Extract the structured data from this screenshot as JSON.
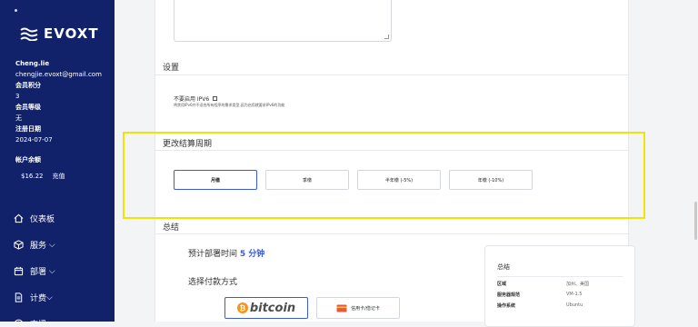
{
  "brand": {
    "name": "EVOXT"
  },
  "account": {
    "username": "Cheng.lie",
    "email": "chengjie.evoxt@gmail.com",
    "points_label": "会员积分",
    "points_value": "3",
    "level_label": "会员等级",
    "level_value": "无",
    "reg_label": "注册日期",
    "reg_value": "2024-07-07",
    "balance_label": "帐户余额",
    "balance_value": "$16.22",
    "recharge_label": "充值"
  },
  "nav": {
    "items": [
      {
        "label": "仪表板",
        "icon": "home-icon"
      },
      {
        "label": "服务",
        "icon": "box-icon"
      },
      {
        "label": "部署",
        "icon": "calendar-icon"
      },
      {
        "label": "计费",
        "icon": "document-icon"
      },
      {
        "label": "支援",
        "icon": "help-icon"
      }
    ]
  },
  "settings": {
    "title": "设置",
    "ipv6_label": "不要启用 IPV6",
    "ipv6_note": "将禁用IPv6并不适合所有程序的需求类型,因为启用就要求IPv6的功能"
  },
  "billing_cycle": {
    "title": "更改结算周期",
    "options": [
      "月缴",
      "季缴",
      "半年缴 (-5%)",
      "年缴 (-10%)"
    ],
    "selected": "月缴"
  },
  "summary_section": {
    "title": "总结",
    "deploy_prefix": "预计部署时间",
    "deploy_value": "5 分钟",
    "payment_label": "选择付款方式",
    "bitcoin_label": "bitcoin",
    "card_label": "信用卡/借记卡"
  },
  "summary_box": {
    "title": "总结",
    "rows": [
      {
        "k": "区域",
        "v": "加州、美国"
      },
      {
        "k": "服务器规范",
        "v": "VM-1.5"
      },
      {
        "k": "操作系统",
        "v": "Ubuntu"
      }
    ]
  },
  "colors": {
    "sidebar": "#11226b",
    "accent": "#3b5bd9",
    "highlight": "#f2e300",
    "bitcoin": "#f7931a"
  }
}
